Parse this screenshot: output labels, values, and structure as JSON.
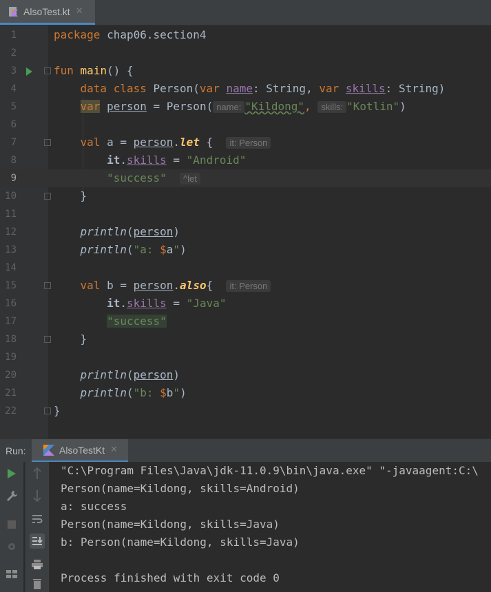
{
  "tab": {
    "label": "AlsoTest.kt",
    "close": "✕"
  },
  "lines": [
    {
      "n": "1"
    },
    {
      "n": "2"
    },
    {
      "n": "3"
    },
    {
      "n": "4"
    },
    {
      "n": "5"
    },
    {
      "n": "6"
    },
    {
      "n": "7"
    },
    {
      "n": "8"
    },
    {
      "n": "9"
    },
    {
      "n": "10"
    },
    {
      "n": "11"
    },
    {
      "n": "12"
    },
    {
      "n": "13"
    },
    {
      "n": "14"
    },
    {
      "n": "15"
    },
    {
      "n": "16"
    },
    {
      "n": "17"
    },
    {
      "n": "18"
    },
    {
      "n": "19"
    },
    {
      "n": "20"
    },
    {
      "n": "21"
    },
    {
      "n": "22"
    }
  ],
  "code": {
    "package_kw": "package",
    "package_name": " chap06.section4",
    "fun_kw": "fun",
    "main_fn": "main",
    "main_rest": "() {",
    "data_class": "data class",
    "person_cls": " Person(",
    "var1": "var",
    "name_prop": "name",
    "type1": ": String, ",
    "var2": "var",
    "skills_prop": "skills",
    "type2": ": String)",
    "var3": "var",
    "person_var": "person",
    "assign_person": " = Person(",
    "hint_name": "name:",
    "kildong": "\"Kildong\"",
    "comma": ", ",
    "hint_skills": "skills:",
    "kotlin": "\"Kotlin\"",
    "close_paren": ")",
    "val_a": "val",
    "a_assign": " a = ",
    "person_ref": "person",
    "dot": ".",
    "let_fn": "let",
    "open_brace": " {",
    "hint_it": "it: Person",
    "it_kw": "it",
    "skills_ref": "skills",
    "eq": " = ",
    "android": "\"Android\"",
    "success": "\"success\"",
    "hint_let": "^let",
    "close_brace": "}",
    "println": "println",
    "paren_open": "(",
    "paren_close": ")",
    "str_a_open": "\"a: ",
    "tmpl_a": "$",
    "str_a_var": "a",
    "str_close": "\"",
    "val_b": "val",
    "b_assign": " b = ",
    "also_fn": "also",
    "brace_no_space": "{",
    "java": "\"Java\"",
    "str_b_open": "\"b: ",
    "str_b_var": "b",
    "final_brace": "}"
  },
  "run": {
    "label": "Run:",
    "tab_label": "AlsoTestKt",
    "close": "✕"
  },
  "console": [
    "\"C:\\Program Files\\Java\\jdk-11.0.9\\bin\\java.exe\" \"-javaagent:C:\\",
    "Person(name=Kildong, skills=Android)",
    "a: success",
    "Person(name=Kildong, skills=Java)",
    "b: Person(name=Kildong, skills=Java)",
    "",
    "Process finished with exit code 0"
  ]
}
